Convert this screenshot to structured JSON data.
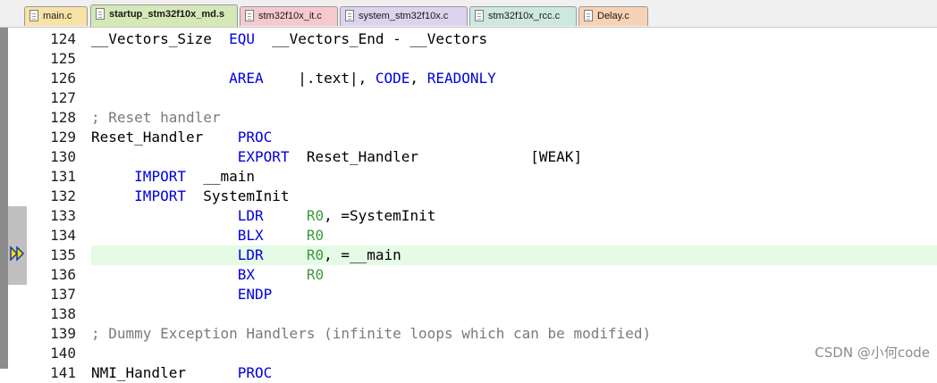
{
  "tabs": [
    {
      "label": "main.c",
      "color": "#f7e3a6",
      "active": false
    },
    {
      "label": "startup_stm32f10x_md.s",
      "color": "#d6e8b8",
      "active": true
    },
    {
      "label": "stm32f10x_it.c",
      "color": "#f6c9cf",
      "active": false
    },
    {
      "label": "system_stm32f10x.c",
      "color": "#dcd3ef",
      "active": false
    },
    {
      "label": "stm32f10x_rcc.c",
      "color": "#cde8e0",
      "active": false
    },
    {
      "label": "Delay.c",
      "color": "#f7d2b5",
      "active": false
    }
  ],
  "editor": {
    "current_line": "135",
    "lines": [
      {
        "num": "124",
        "tokens": [
          [
            "pl",
            "__Vectors_Size  "
          ],
          [
            "kw",
            "EQU"
          ],
          [
            "pl",
            "  __Vectors_End - __Vectors"
          ]
        ]
      },
      {
        "num": "125",
        "tokens": []
      },
      {
        "num": "126",
        "tokens": [
          [
            "pl",
            "                "
          ],
          [
            "kw",
            "AREA"
          ],
          [
            "pl",
            "    |.text|, "
          ],
          [
            "kw",
            "CODE"
          ],
          [
            "pl",
            ", "
          ],
          [
            "kw",
            "READONLY"
          ]
        ]
      },
      {
        "num": "127",
        "tokens": []
      },
      {
        "num": "128",
        "tokens": [
          [
            "cm",
            "; Reset handler"
          ]
        ]
      },
      {
        "num": "129",
        "tokens": [
          [
            "pl",
            "Reset_Handler    "
          ],
          [
            "kw",
            "PROC"
          ]
        ]
      },
      {
        "num": "130",
        "tokens": [
          [
            "pl",
            "                 "
          ],
          [
            "kw",
            "EXPORT"
          ],
          [
            "pl",
            "  Reset_Handler             [WEAK]"
          ]
        ]
      },
      {
        "num": "131",
        "tokens": [
          [
            "pl",
            "     "
          ],
          [
            "kw",
            "IMPORT"
          ],
          [
            "pl",
            "  __main"
          ]
        ]
      },
      {
        "num": "132",
        "tokens": [
          [
            "pl",
            "     "
          ],
          [
            "kw",
            "IMPORT"
          ],
          [
            "pl",
            "  SystemInit"
          ]
        ]
      },
      {
        "num": "133",
        "tokens": [
          [
            "pl",
            "                 "
          ],
          [
            "kw",
            "LDR"
          ],
          [
            "pl",
            "     "
          ],
          [
            "reg",
            "R0"
          ],
          [
            "pl",
            ", =SystemInit"
          ]
        ]
      },
      {
        "num": "134",
        "tokens": [
          [
            "pl",
            "                 "
          ],
          [
            "kw",
            "BLX"
          ],
          [
            "pl",
            "     "
          ],
          [
            "reg",
            "R0"
          ]
        ]
      },
      {
        "num": "135",
        "tokens": [
          [
            "pl",
            "                 "
          ],
          [
            "kw",
            "LDR"
          ],
          [
            "pl",
            "     "
          ],
          [
            "reg",
            "R0"
          ],
          [
            "pl",
            ", =__main"
          ]
        ]
      },
      {
        "num": "136",
        "tokens": [
          [
            "pl",
            "                 "
          ],
          [
            "kw",
            "BX"
          ],
          [
            "pl",
            "      "
          ],
          [
            "reg",
            "R0"
          ]
        ]
      },
      {
        "num": "137",
        "tokens": [
          [
            "pl",
            "                 "
          ],
          [
            "kw",
            "ENDP"
          ]
        ]
      },
      {
        "num": "138",
        "tokens": []
      },
      {
        "num": "139",
        "tokens": [
          [
            "cm",
            "; Dummy Exception Handlers (infinite loops which can be modified)"
          ]
        ]
      },
      {
        "num": "140",
        "tokens": []
      },
      {
        "num": "141",
        "tokens": [
          [
            "pl",
            "NMI_Handler      "
          ],
          [
            "kw",
            "PROC"
          ]
        ]
      }
    ]
  },
  "watermark": "CSDN @小何code"
}
